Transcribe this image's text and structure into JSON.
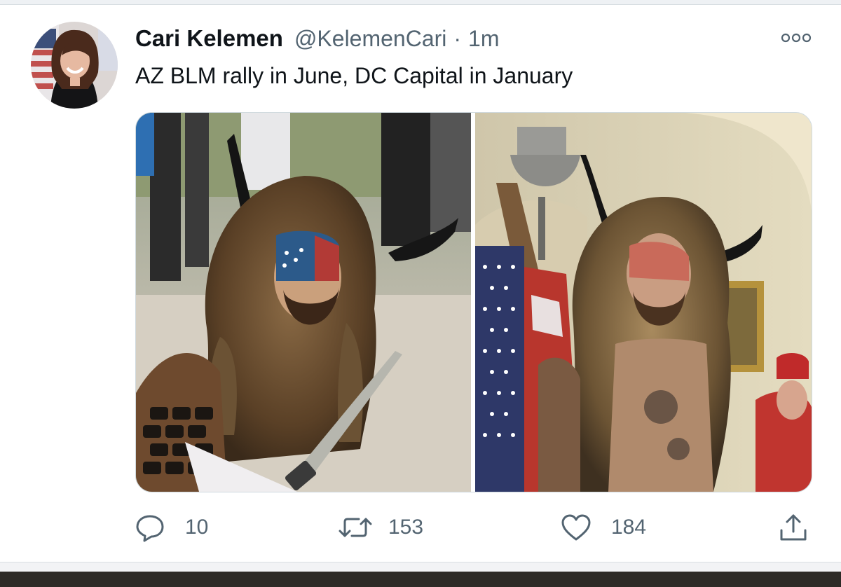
{
  "tweet": {
    "author_name": "Cari Kelemen",
    "handle": "@KelemenCari",
    "separator": "·",
    "time": "1m",
    "text": "AZ BLM rally in June, DC Capital in January"
  },
  "media": {
    "photos": [
      {
        "name": "photo-az-rally"
      },
      {
        "name": "photo-dc-capitol"
      }
    ]
  },
  "actions": {
    "reply_count": "10",
    "retweet_count": "153",
    "like_count": "184"
  },
  "icons": {
    "more": "more-options-icon",
    "reply": "reply-icon",
    "retweet": "retweet-icon",
    "like": "heart-icon",
    "share": "share-icon"
  },
  "colors": {
    "text": "#0f1419",
    "secondary": "#536471",
    "border": "#cfd9de"
  }
}
